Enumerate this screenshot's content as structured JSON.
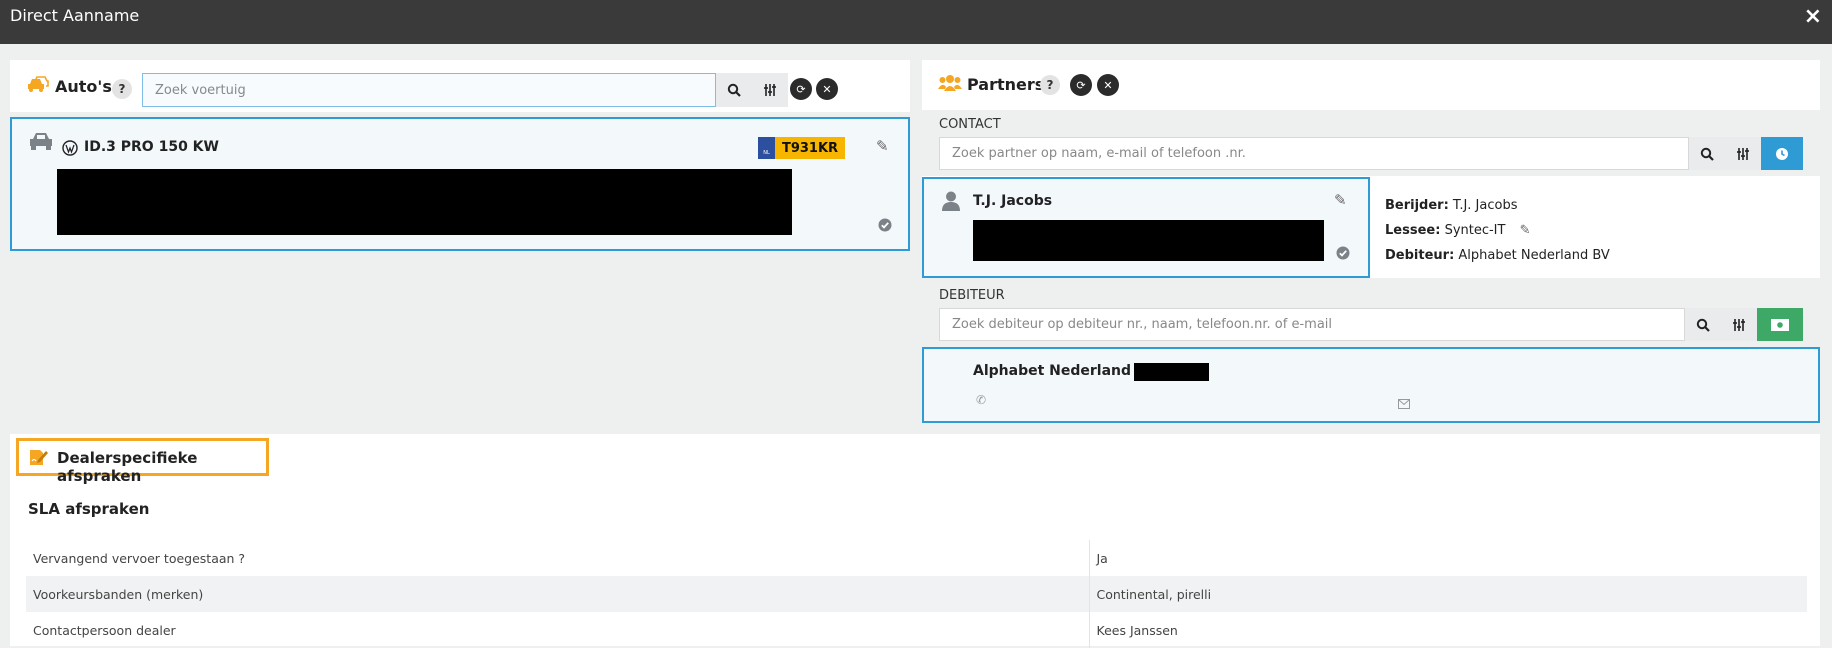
{
  "window": {
    "title": "Direct Aanname",
    "close_icon": "×"
  },
  "autos": {
    "title": "Auto's",
    "help": "?",
    "search_placeholder": "Zoek voertuig",
    "vehicle": {
      "brand_icon": "volkswagen-logo",
      "name": "ID.3 PRO 150 KW",
      "plate_country": "NL",
      "plate": "T931KR"
    }
  },
  "partners": {
    "title": "Partners",
    "help": "?",
    "contact_label": "CONTACT",
    "contact_placeholder": "Zoek partner op naam, e-mail of telefoon .nr.",
    "contact_card": {
      "name": "T.J. Jacobs"
    },
    "details": {
      "berijder_label": "Berijder:",
      "berijder_value": "T.J. Jacobs",
      "lessee_label": "Lessee:",
      "lessee_value": "Syntec-IT",
      "debiteur_label": "Debiteur:",
      "debiteur_value": "Alphabet Nederland BV"
    },
    "debiteur_label": "DEBITEUR",
    "debiteur_placeholder": "Zoek debiteur op debiteur nr., naam, telefoon.nr. of e-mail",
    "debiteur_card": {
      "name": "Alphabet Nederland BV"
    }
  },
  "dealer": {
    "title": "Dealerspecifieke afspraken",
    "sla_title": "SLA afspraken",
    "rows": [
      {
        "label": "Vervangend vervoer toegestaan ?",
        "value": "Ja"
      },
      {
        "label": "Voorkeursbanden (merken)",
        "value": "Continental, pirelli"
      },
      {
        "label": "Contactpersoon dealer",
        "value": "Kees Janssen"
      }
    ]
  },
  "colors": {
    "accent_blue": "#2f9bd4",
    "orange": "#f5a623",
    "green": "#3ea867",
    "plate_yellow": "#f7b500"
  }
}
